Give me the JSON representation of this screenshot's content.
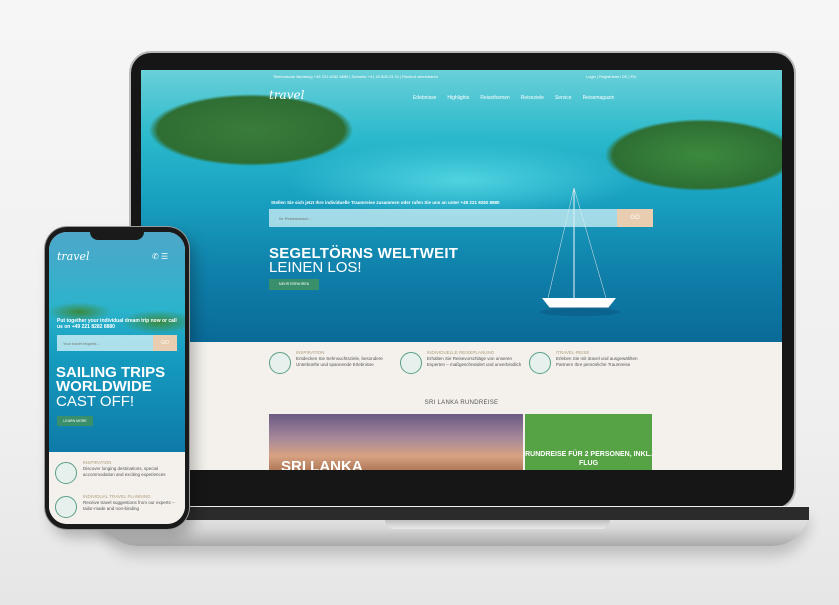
{
  "desktop": {
    "topbar": {
      "left": "Telefonische Beratung  +49 221 8282 8880  |  Schweiz +41 43 508 23 34  |  Rückruf vereinbaren",
      "right": "Login  |  Registrieren    DE | EN"
    },
    "logo": "travel",
    "nav": [
      "Erlebnisse",
      "Highlights",
      "Reisethemen",
      "Reiseziele",
      "Service",
      "Reisemagazin"
    ],
    "hero": {
      "tagline": "Stellen Sie sich jetzt Ihre individuelle Traumreise zusammen oder rufen Sie uns an unter +49 221 8282 8880",
      "search_placeholder": "Ihr Reisewunsch ...",
      "search_button": "GO",
      "title": "SEGELTÖRNS WELTWEIT",
      "subtitle": "LEINEN LOS!",
      "cta": "MEHR ERFAHREN"
    },
    "features": [
      {
        "title": "INSPIRATION",
        "text": "Entdecken Sie Sehnsuchtsziele, besondere Unterkünfte und spannende Erlebnisse"
      },
      {
        "title": "INDIVIDUELLE REISEPLANUNG",
        "text": "Erhalten Sie Reisevorschläge von unseren Experten – maßgeschneidert und unverbindlich"
      },
      {
        "title": "ITRAVEL-REISE",
        "text": "Erleben Sie mit itravel und ausgewählten Partnern Ihre persönliche Traumreise"
      }
    ],
    "section_title": "SRI LANKA RUNDREISE",
    "promo_label": "SRI LANKA",
    "promo_green": "RUNDREISE FÜR 2 PERSONEN, INKL. FLUG"
  },
  "mobile": {
    "logo": "travel",
    "tagline": "Put together your individual dream trip now or call us on +49 221 8282 8880",
    "search_placeholder": "Your travel request...",
    "search_button": "GO",
    "title": "SAILING TRIPS WORLDWIDE",
    "subtitle": "CAST OFF!",
    "cta": "LEARN MORE",
    "features": [
      {
        "title": "INSPIRATION",
        "text": "Discover longing destinations, special accommodation and exciting experiences"
      },
      {
        "title": "INDIVIDUAL TRAVEL PLANNING",
        "text": "Receive travel suggestions from our experts – tailor-made and non-binding"
      }
    ]
  },
  "colors": {
    "accent_green": "#3a8f6b",
    "go_button": "#e8cdb0",
    "promo_green": "#55a344",
    "feature_title": "#b09a7c"
  },
  "icons": {
    "features": [
      "telescope-icon",
      "planning-icon",
      "balloon-icon"
    ],
    "mobile_header": [
      "phone-icon",
      "menu-icon"
    ]
  }
}
